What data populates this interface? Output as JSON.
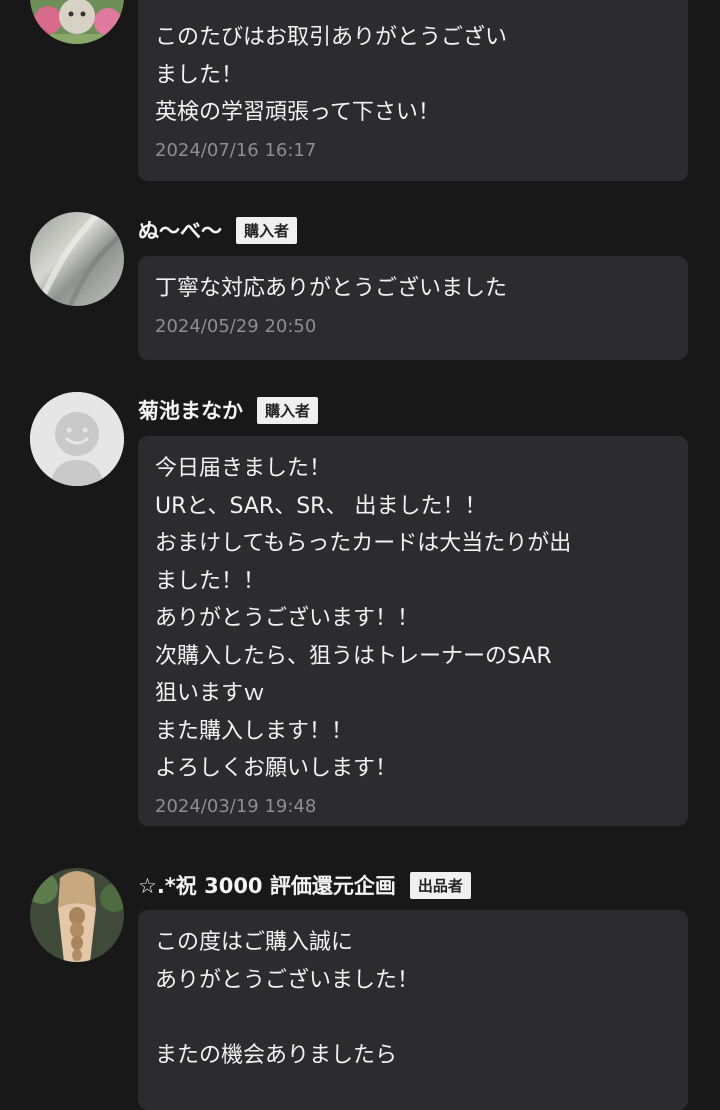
{
  "reviews": [
    {
      "name": "",
      "role": "",
      "message": "このたびはお取引ありがとうござい\nました！\n英検の学習頑張って下さい！",
      "date": "2024/07/16 16:17",
      "avatar": "cat-flowers-photo"
    },
    {
      "name": "ぬ〜べ〜",
      "role": "購入者",
      "message": "丁寧な対応ありがとうございました",
      "date": "2024/05/29 20:50",
      "avatar": "gray-fabric-photo"
    },
    {
      "name": "菊池まなか",
      "role": "購入者",
      "message": "今日届きました！\nURと、SAR、SR、 出ました！！\nおまけしてもらったカードは大当たりが出\nました！！\nありがとうございます！！\n次購入したら、狙うはトレーナーのSAR\n狙いますｗ\nまた購入します！！\nよろしくお願いします！",
      "date": "2024/03/19 19:48",
      "avatar": "default-smiley"
    },
    {
      "name": "☆.*祝 3000 評価還元企画",
      "role": "出品者",
      "message": "この度はご購入誠に\nありがとうございました！\n\nまたの機会ありましたら",
      "date": "",
      "avatar": "braided-hair-photo"
    }
  ]
}
